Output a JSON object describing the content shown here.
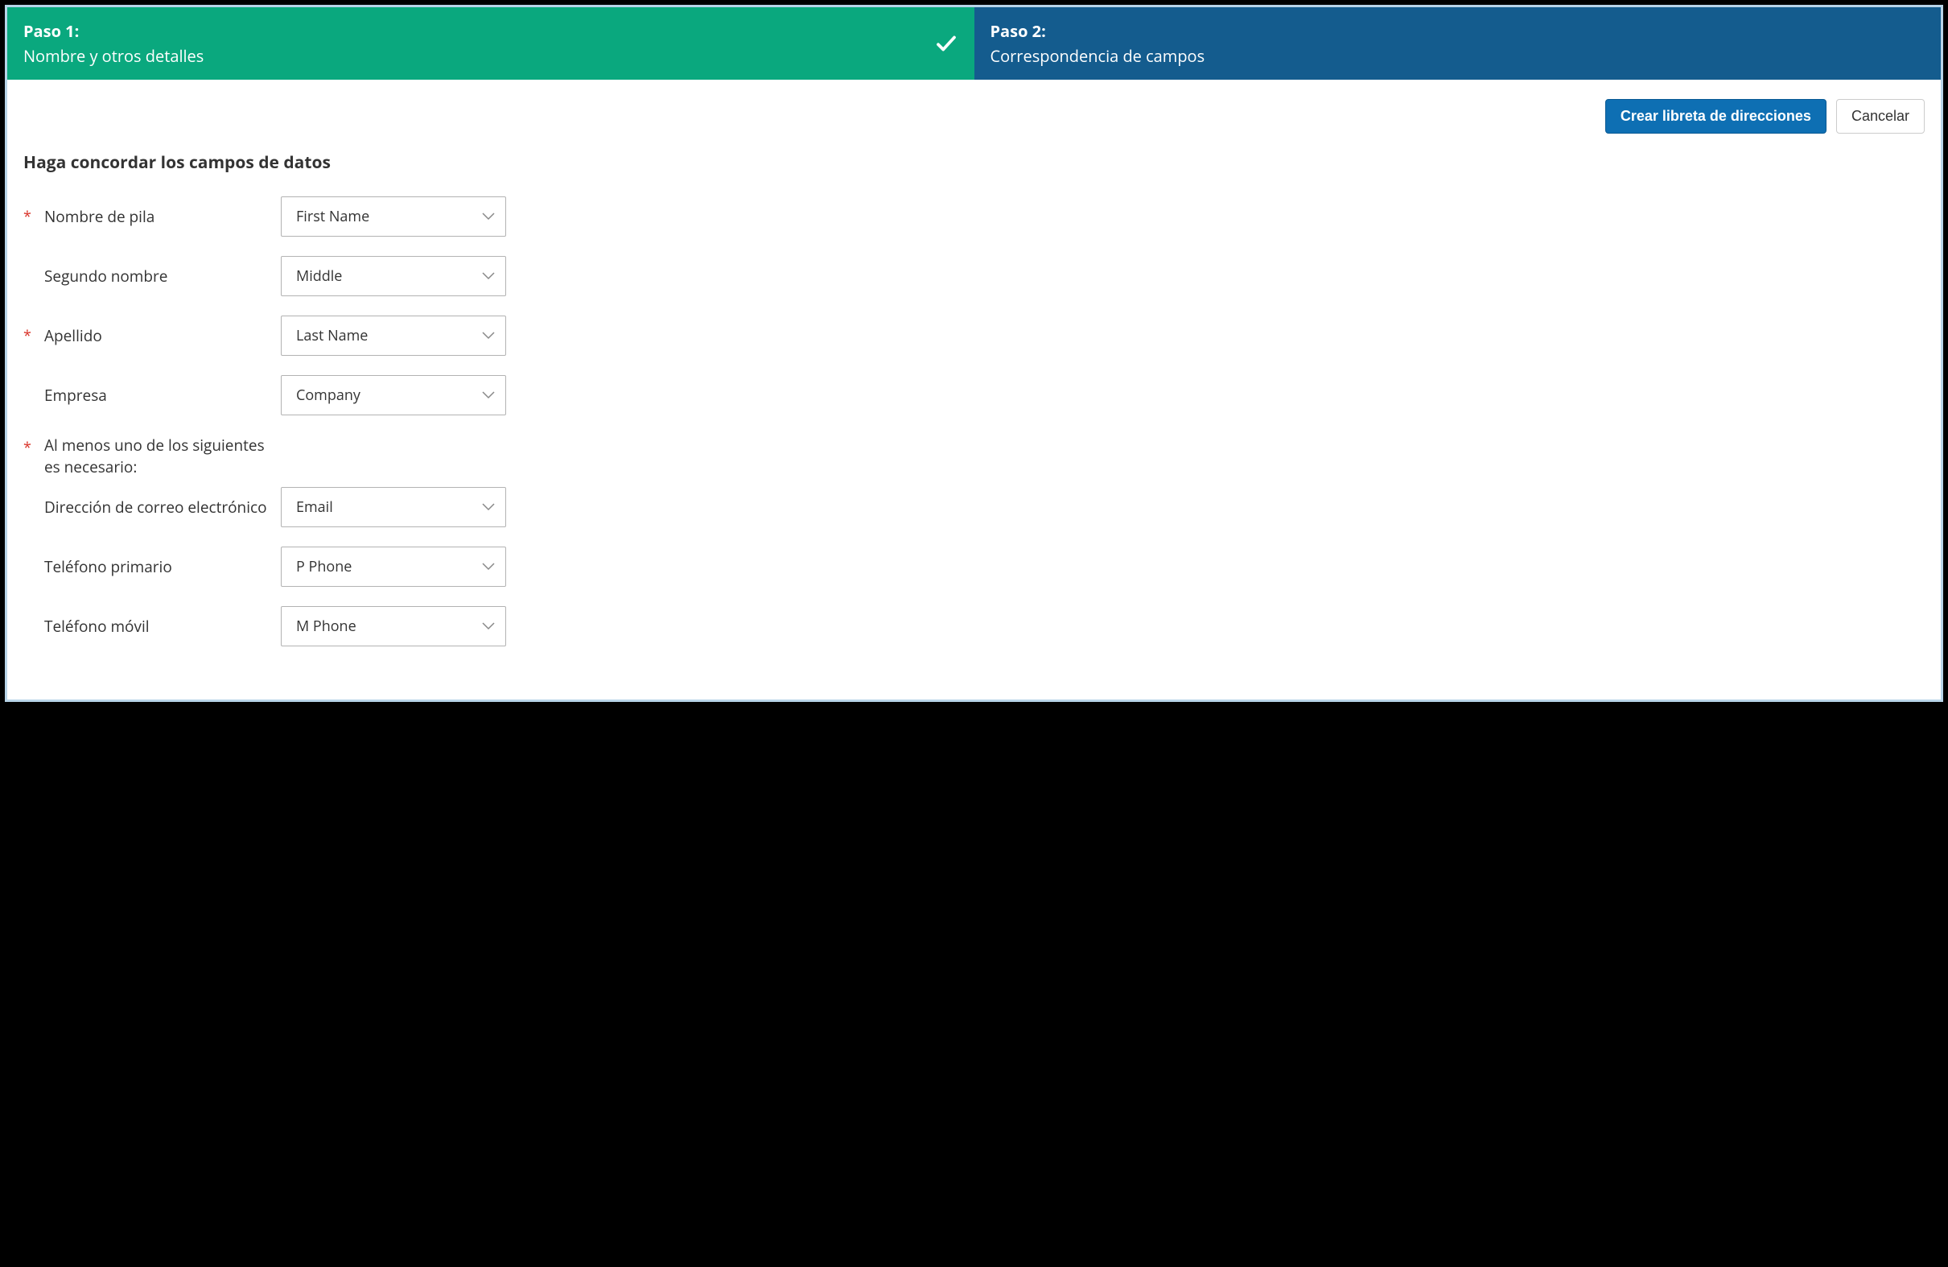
{
  "steps": {
    "step1": {
      "num": "Paso 1:",
      "title": "Nombre y otros detalles"
    },
    "step2": {
      "num": "Paso 2:",
      "title": "Correspondencia de campos"
    }
  },
  "actions": {
    "create": "Crear libreta de direcciones",
    "cancel": "Cancelar"
  },
  "section_title": "Haga concordar los campos de datos",
  "required_marker": "*",
  "fields": {
    "first_name": {
      "label": "Nombre de pila",
      "value": "First Name",
      "required": true
    },
    "middle_name": {
      "label": "Segundo nombre",
      "value": "Middle",
      "required": false
    },
    "last_name": {
      "label": "Apellido",
      "value": "Last Name",
      "required": true
    },
    "company": {
      "label": "Empresa",
      "value": "Company",
      "required": false
    },
    "at_least_one_note": "Al menos uno de los siguientes es necesario:",
    "email": {
      "label": "Dirección de correo electrónico",
      "value": "Email",
      "required": false
    },
    "primary_phone": {
      "label": "Teléfono primario",
      "value": "P Phone",
      "required": false
    },
    "mobile_phone": {
      "label": "Teléfono móvil",
      "value": "M Phone",
      "required": false
    }
  }
}
